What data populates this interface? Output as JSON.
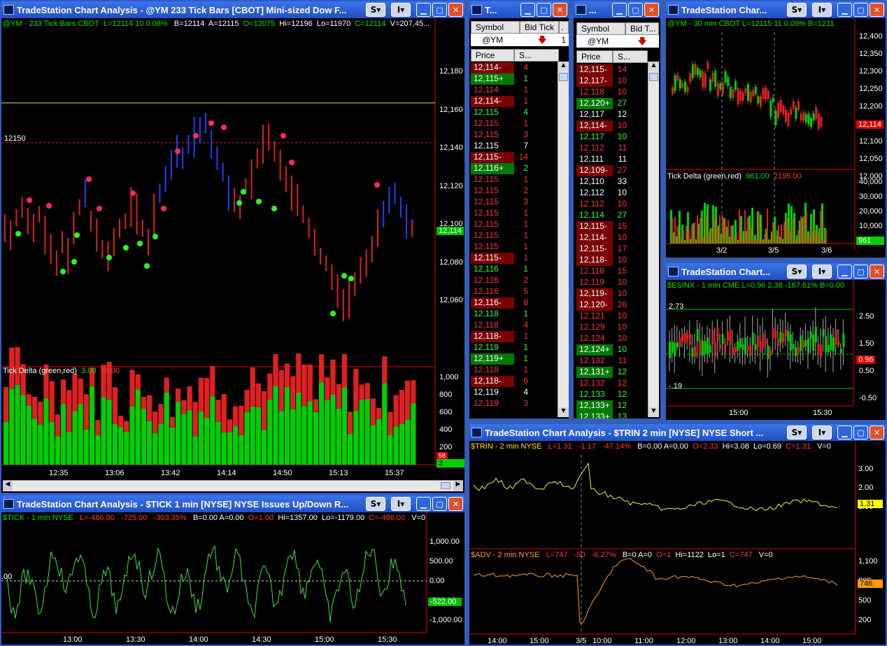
{
  "windows": {
    "ym_tick": {
      "title": "TradeStation Chart Analysis - @YM  233 Tick Bars [CBOT] Mini-sized Dow F...",
      "hdr": {
        "sym": "@YM - 233 Tick Bars  CBOT",
        "last": "L=12114  10  0.08%",
        "bid": "B=12114",
        "ask": "A=12115",
        "open": "O=12075",
        "hi": "Hi=12196",
        "lo": "Lo=11970",
        "close": "C=12114",
        "vol": "V=207,45..."
      },
      "price_axis": [
        "12,180",
        "12,160",
        "12,140",
        "12,120",
        "12,100",
        "12,080",
        "12,060"
      ],
      "level_label": "12150",
      "last_tag": "12,114",
      "delta_label": "Tick Delta (green,red)",
      "delta_green": "3.00",
      "delta_red": "58.00",
      "delta_axis": [
        "1,000",
        "800",
        "600",
        "400",
        "200"
      ],
      "delta_tag_red": "58",
      "delta_tag_green": "3",
      "time_axis": [
        "12:35",
        "13:06",
        "13:42",
        "14:14",
        "14:50",
        "15:13",
        "15:37"
      ]
    },
    "md1": {
      "title": "T...",
      "col_symbol": "Symbol",
      "col_bid": "Bid Tick",
      "col_extra": ".",
      "symbol": "@YM",
      "extra_val": "1",
      "col_price": "Price",
      "col_size": "S...",
      "rows": [
        [
          "12,114-",
          "4",
          "r"
        ],
        [
          "12,115+",
          "1",
          "g"
        ],
        [
          "12,114",
          "1",
          "rt"
        ],
        [
          "12,114-",
          "1",
          "r"
        ],
        [
          "12,115",
          "4",
          "gt"
        ],
        [
          "12,115",
          "1",
          "rt"
        ],
        [
          "12,115",
          "3",
          "rt"
        ],
        [
          "12,115",
          "7",
          "wt"
        ],
        [
          "12,115-",
          "14",
          "r"
        ],
        [
          "12,116+",
          "2",
          "g"
        ],
        [
          "12,115",
          "1",
          "rt"
        ],
        [
          "12,115",
          "2",
          "rt"
        ],
        [
          "12,115",
          "3",
          "rt"
        ],
        [
          "12,115",
          "1",
          "rt"
        ],
        [
          "12,115",
          "1",
          "rt"
        ],
        [
          "12,115",
          "1",
          "rt"
        ],
        [
          "12,115",
          "1",
          "rt"
        ],
        [
          "12,115-",
          "1",
          "r"
        ],
        [
          "12,116",
          "1",
          "gt"
        ],
        [
          "12,116",
          "2",
          "rt"
        ],
        [
          "12,116",
          "5",
          "rt"
        ],
        [
          "12,116-",
          "8",
          "r"
        ],
        [
          "12,118",
          "1",
          "gt"
        ],
        [
          "12,118",
          "4",
          "rt"
        ],
        [
          "12,118-",
          "1",
          "r"
        ],
        [
          "12,119",
          "1",
          "gt"
        ],
        [
          "12,119+",
          "1",
          "g"
        ],
        [
          "12,118",
          "1",
          "rt"
        ],
        [
          "12,118-",
          "6",
          "r"
        ],
        [
          "12,119",
          "4",
          "wt"
        ],
        [
          "12,119",
          "3",
          "rt"
        ]
      ]
    },
    "md2": {
      "title": "...",
      "col_symbol": "Symbol",
      "col_bid": "Bid T...",
      "symbol": "@YM",
      "col_price": "Price",
      "col_size": "S...",
      "rows": [
        [
          "12,115-",
          "14",
          "r"
        ],
        [
          "12,117-",
          "10",
          "r"
        ],
        [
          "12,118",
          "10",
          "rt"
        ],
        [
          "12,120+",
          "27",
          "g"
        ],
        [
          "12,117",
          "12",
          "wt"
        ],
        [
          "12,114-",
          "10",
          "r"
        ],
        [
          "12,117",
          "10",
          "gt"
        ],
        [
          "12,112",
          "11",
          "rt"
        ],
        [
          "12,111",
          "11",
          "wt"
        ],
        [
          "12,109-",
          "27",
          "r"
        ],
        [
          "12,110",
          "33",
          "wt"
        ],
        [
          "12,112",
          "10",
          "wt"
        ],
        [
          "12,112",
          "10",
          "rt"
        ],
        [
          "12,114",
          "27",
          "gt"
        ],
        [
          "12,115-",
          "15",
          "r"
        ],
        [
          "12,114-",
          "10",
          "r"
        ],
        [
          "12,115-",
          "17",
          "r"
        ],
        [
          "12,118-",
          "10",
          "r"
        ],
        [
          "12,118",
          "15",
          "rt"
        ],
        [
          "12,119",
          "10",
          "rt"
        ],
        [
          "12,119-",
          "10",
          "r"
        ],
        [
          "12,120-",
          "26",
          "r"
        ],
        [
          "12,121",
          "10",
          "rt"
        ],
        [
          "12,129",
          "10",
          "rt"
        ],
        [
          "12,124",
          "10",
          "rt"
        ],
        [
          "12,124+",
          "10",
          "g"
        ],
        [
          "12,132",
          "11",
          "rt"
        ],
        [
          "12,131+",
          "12",
          "g"
        ],
        [
          "12,132",
          "12",
          "rt"
        ],
        [
          "12,133",
          "12",
          "gt"
        ],
        [
          "12,133+",
          "12",
          "g"
        ],
        [
          "12,133+",
          "13",
          "g"
        ]
      ]
    },
    "ym30": {
      "title": "TradeStation Char...",
      "hdr": "@YM - 30 min  CBOT  L=12115  11  0.09%  B=1211",
      "price_axis": [
        "12,400",
        "12,350",
        "12,300",
        "12,250",
        "12,200",
        "12,150",
        "12,100",
        "12,050",
        "12,000"
      ],
      "last_tag": "12,114",
      "delta_label": "Tick Delta (green,red)",
      "delta_green": "961.00",
      "delta_red": "2195.00",
      "delta_axis": [
        "40,000",
        "30,000",
        "20,000",
        "10,000"
      ],
      "delta_tag": "961",
      "time_axis": [
        "3/2",
        "3/5",
        "3/6"
      ]
    },
    "esinx": {
      "title": "TradeStation Chart...",
      "hdr": "$ESINX - 1 min  CME  L=0.96  2.38  -167.61%  B=0.00",
      "price_axis": [
        "2.50",
        "1.50",
        "0.50",
        "-0.50"
      ],
      "level_hi": "2.73",
      "level_lo": "-.19",
      "last_tag": "0.96",
      "time_axis": [
        "15:00",
        "15:30"
      ]
    },
    "tick": {
      "title": "TradeStation Chart Analysis - $TICK  1 min  [NYSE] NYSE Issues Up/Down R...",
      "hdr": {
        "sym": "$TICK - 1 min  NYSE",
        "last": "L=-486.00",
        "chg": "-725.00",
        "pct": "-303.35%",
        "rest": "B=0.00  A=0.00",
        "open": "O=1.00",
        "hi": "Hi=1357.00",
        "lo": "Lo=-1179.00",
        "close": "C=-486.00",
        "vol": "V=0"
      },
      "price_axis": [
        "1,000.00",
        "500.00",
        "0.00",
        "-500.00",
        "-1,000.00"
      ],
      "zero_label": ".00",
      "last_tag": "-522.00",
      "time_axis": [
        "13:00",
        "13:30",
        "14:00",
        "14:30",
        "15:00",
        "15:30"
      ]
    },
    "trin": {
      "title": "TradeStation Chart Analysis - $TRIN  2 min  [NYSE] NYSE Short ...",
      "hdr": {
        "sym": "$TRIN - 2 min  NYSE",
        "last": "L=1.31",
        "chg": "-1.17",
        "pct": "-47.14%",
        "rest": "B=0.00  A=0.00",
        "open": "O=2.33",
        "hi": "Hi=3.08",
        "lo": "Lo=0.69",
        "close": "C=1.31",
        "vol": "V=0"
      },
      "trin_axis": [
        "3.00",
        "2.00",
        "1.00"
      ],
      "trin_tag": "1.31",
      "adv_hdr": {
        "sym": "$ADV - 2 min  NYSE",
        "last": "L=747",
        "chg": "-50",
        "pct": "-6.27%",
        "rest": "B=0  A=0",
        "open": "O=1",
        "hi": "Hi=1122",
        "lo": "Lo=1",
        "close": "C=747",
        "vol": "V=0"
      },
      "adv_axis": [
        "1,100",
        "800",
        "500",
        "200"
      ],
      "adv_tag": "746",
      "time_axis": [
        "14:00",
        "15:00",
        "3/5",
        "10:00",
        "11:00",
        "12:00",
        "13:00",
        "14:00",
        "15:00"
      ]
    }
  },
  "colors": {
    "up": "#00d000",
    "down": "#e02020",
    "bluebar": "#2040ff",
    "titlebar": "#2456d8"
  }
}
